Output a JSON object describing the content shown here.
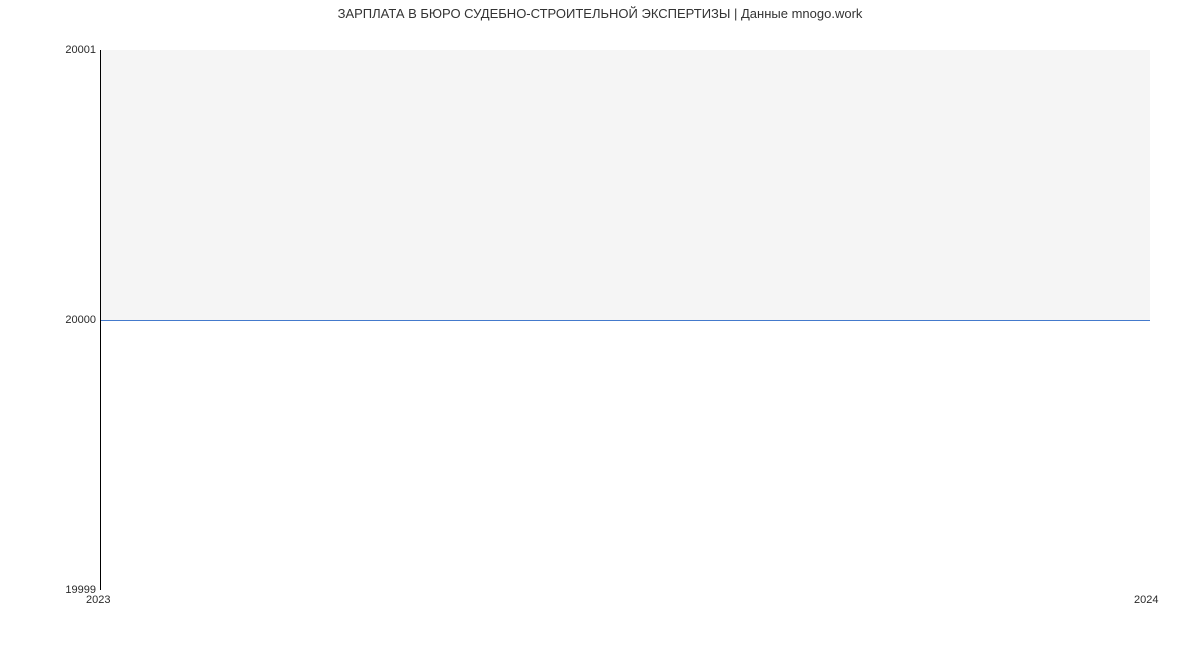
{
  "chart_data": {
    "type": "line",
    "title": "ЗАРПЛАТА В БЮРО СУДЕБНО-СТРОИТЕЛЬНОЙ ЭКСПЕРТИЗЫ | Данные mnogo.work",
    "x": [
      "2023",
      "2024"
    ],
    "values": [
      20000,
      20000
    ],
    "xlabel": "",
    "ylabel": "",
    "ylim": [
      19999,
      20001
    ],
    "yticks": [
      19999,
      20000,
      20001
    ],
    "xticks": [
      "2023",
      "2024"
    ],
    "line_color": "#447acc"
  }
}
